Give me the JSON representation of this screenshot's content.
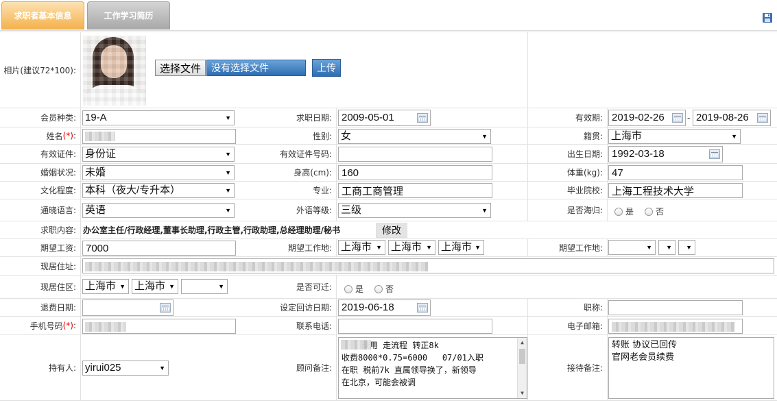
{
  "tabs": [
    {
      "label": "求职者基本信息",
      "active": true
    },
    {
      "label": "工作学习简历",
      "active": false
    }
  ],
  "photo": {
    "label": "相片(建议72*100):",
    "choose_button": "选择文件",
    "file_state": "没有选择文件",
    "upload_button": "上传"
  },
  "fields": {
    "member_type": {
      "label": "会员种类:",
      "value": "19-A"
    },
    "apply_date": {
      "label": "求职日期:",
      "value": "2009-05-01"
    },
    "valid_period": {
      "label": "有效期:",
      "start": "2019-02-26",
      "sep": "-",
      "end": "2019-08-26"
    },
    "name": {
      "label": "姓名",
      "req": "(*)",
      "colon": ":"
    },
    "gender": {
      "label": "性别:",
      "value": "女"
    },
    "native_place": {
      "label": "籍贯:",
      "value": "上海市"
    },
    "id_type": {
      "label": "有效证件:",
      "value": "身份证"
    },
    "id_number": {
      "label": "有效证件号码:",
      "value": ""
    },
    "birth_date": {
      "label": "出生日期:",
      "value": "1992-03-18"
    },
    "marital": {
      "label": "婚姻状况:",
      "value": "未婚"
    },
    "height": {
      "label": "身高(cm):",
      "value": "160"
    },
    "weight": {
      "label": "体重(kg):",
      "value": "47"
    },
    "education": {
      "label": "文化程度:",
      "value": "本科（夜大/专升本）"
    },
    "major": {
      "label": "专业:",
      "value": "工商工商管理"
    },
    "school": {
      "label": "毕业院校:",
      "value": "上海工程技术大学"
    },
    "language": {
      "label": "通晓语言:",
      "value": "英语"
    },
    "foreign_level": {
      "label": "外语等级:",
      "value": "三级"
    },
    "returnee": {
      "label": "是否海归:",
      "yes": "是",
      "no": "否"
    },
    "job_content": {
      "label": "求职内容:",
      "value": "办公室主任/行政经理,董事长助理,行政主管,行政助理,总经理助理/秘书",
      "modify": "修改"
    },
    "expected_salary": {
      "label": "期望工资:",
      "value": "7000"
    },
    "expected_place": {
      "label": "期望工作地:",
      "province": "上海市",
      "city": "上海市",
      "district": "上海市"
    },
    "expected_place2": {
      "label": "期望工作地:"
    },
    "address": {
      "label": "现居住址:"
    },
    "district": {
      "label": "现居住区:",
      "province": "上海市",
      "city": "上海市",
      "district": ""
    },
    "relocate": {
      "label": "是否可迁:",
      "yes": "是",
      "no": "否"
    },
    "refund_date": {
      "label": "退费日期:",
      "value": ""
    },
    "revisit_date": {
      "label": "设定回访日期:",
      "value": "2019-06-18"
    },
    "title": {
      "label": "职称:",
      "value": ""
    },
    "mobile": {
      "label": "手机号码",
      "req": "(*)",
      "colon": ":"
    },
    "phone": {
      "label": "联系电话:",
      "value": ""
    },
    "email": {
      "label": "电子邮箱:"
    },
    "holder": {
      "label": "持有人:",
      "value": "yirui025"
    },
    "advisor_note": {
      "label": "顾问备注:",
      "value": "    录用 走流程 转正8k\n收费8000*0.75=6000   07/01入职\n在职 税前7k 直属领导换了，新领导\n在北京，可能会被调"
    },
    "reception_note": {
      "label": "接待备注:",
      "value": "转账 协议已回传\n官网老会员续费"
    }
  },
  "icons": {
    "save": "save-icon",
    "calendar": "calendar-icon",
    "dropdown": "chevron-down-icon"
  },
  "colors": {
    "tab_active": "#f4b24e",
    "tab_inactive": "#a9a9a9",
    "button_blue": "#2e6db3",
    "required": "#dd0000"
  }
}
